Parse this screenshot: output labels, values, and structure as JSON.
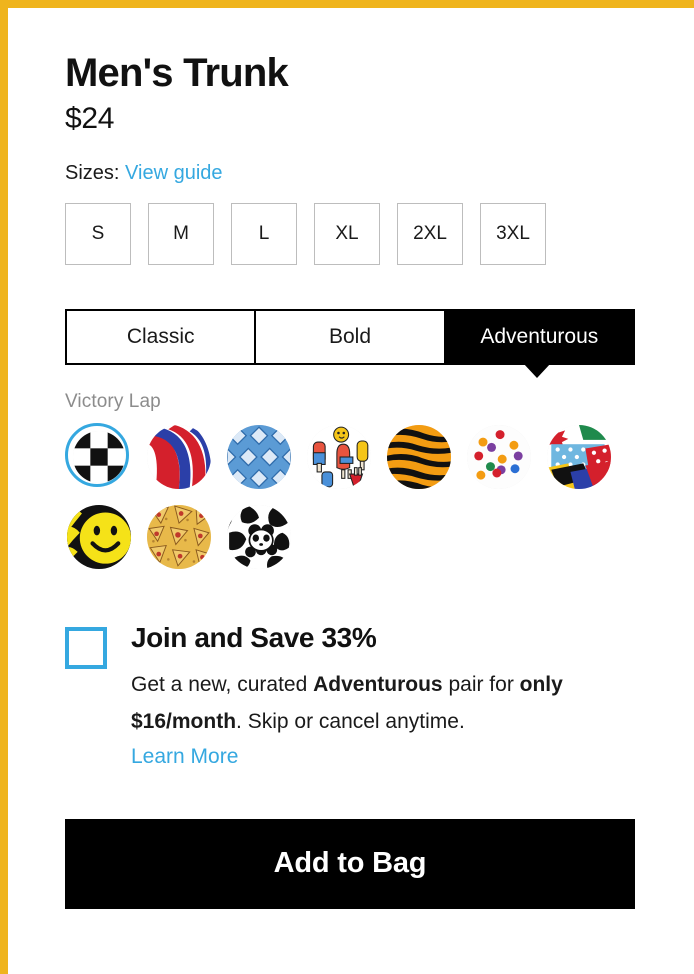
{
  "theme": {
    "frame_color": "#efb41d",
    "link_color": "#35a8e0",
    "accent_color": "#35a8e0",
    "selected_bg": "#000000"
  },
  "product": {
    "title": "Men's Trunk",
    "price": "$24",
    "sizes_label": "Sizes:",
    "size_guide_link": "View guide"
  },
  "sizes": [
    {
      "label": "S"
    },
    {
      "label": "M"
    },
    {
      "label": "L"
    },
    {
      "label": "XL"
    },
    {
      "label": "2XL"
    },
    {
      "label": "3XL"
    }
  ],
  "style_tabs": [
    {
      "label": "Classic",
      "selected": false
    },
    {
      "label": "Bold",
      "selected": false
    },
    {
      "label": "Adventurous",
      "selected": true
    }
  ],
  "collection": {
    "name": "Victory Lap"
  },
  "swatches": [
    {
      "name": "checkerboard",
      "selected": true
    },
    {
      "name": "red-white-blue-swirl",
      "selected": false
    },
    {
      "name": "blue-diamonds",
      "selected": false
    },
    {
      "name": "rockets-popsicles",
      "selected": false
    },
    {
      "name": "tiger-stripes",
      "selected": false
    },
    {
      "name": "confetti-dots",
      "selected": false
    },
    {
      "name": "flag-patchwork",
      "selected": false
    },
    {
      "name": "yellow-smiley",
      "selected": false
    },
    {
      "name": "pizza",
      "selected": false
    },
    {
      "name": "pandas",
      "selected": false
    }
  ],
  "subscribe": {
    "checked": false,
    "title": "Join and Save 33%",
    "desc_part1": "Get a new, curated ",
    "desc_bold1": "Adventurous",
    "desc_part2": " pair for ",
    "desc_bold2": "only $16/month",
    "desc_part3": ". Skip or cancel anytime.",
    "learn_more": "Learn More"
  },
  "cta": {
    "label": "Add to Bag"
  }
}
